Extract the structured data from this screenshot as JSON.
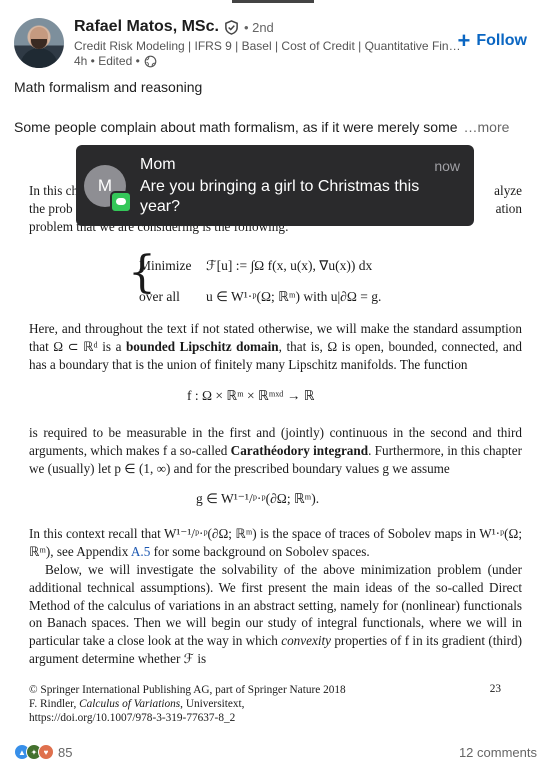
{
  "author": {
    "name": "Rafael Matos, MSc.",
    "degree": "• 2nd",
    "headline": "Credit Risk Modeling | IFRS 9 | Basel | Cost of Credit | Quantitative Finan…",
    "meta": "4h • Edited •"
  },
  "follow_label": "Follow",
  "post": {
    "title": "Math formalism and reasoning",
    "body": "Some people complain about math formalism, as if it were merely some",
    "more": "…more"
  },
  "notification": {
    "initial": "M",
    "sender": "Mom",
    "time": "now",
    "message": "Are you bringing a girl to Christmas this year?"
  },
  "page": {
    "line1a": "In this ch",
    "line1b": "alyze",
    "line2a": "the prob",
    "line2b": "ation",
    "line3": "problem that we are considering is the following:",
    "eq_min_label": "Minimize",
    "eq_min": "ℱ[u] := ∫Ω f(x, u(x), ∇u(x)) dx",
    "eq_over_label": "over all",
    "eq_over": "u ∈ W¹·ᵖ(Ω; ℝᵐ) with u|∂Ω = g.",
    "para1_pre": "Here, and throughout the text if not stated otherwise, we will make the standard assumption that Ω ⊂ ℝᵈ is a ",
    "para1_bold": "bounded Lipschitz domain",
    "para1_post": ", that is, Ω is open, bounded, connected, and has a boundary that is the union of finitely many Lipschitz manifolds. The function",
    "eq_f": "f : Ω × ℝᵐ × ℝᵐˣᵈ → ℝ",
    "para2_pre": "is required to be measurable in the first and (jointly) continuous in the second and third arguments, which makes f a so-called ",
    "para2_bold": "Carathéodory integrand",
    "para2_post": ". Furthermore, in this chapter we (usually) let p ∈ (1, ∞) and for the prescribed boundary values g we assume",
    "eq_g": "g ∈ W¹⁻¹/ᵖ·ᵖ(∂Ω; ℝᵐ).",
    "para3_pre": "In this context recall that W¹⁻¹/ᵖ·ᵖ(∂Ω; ℝᵐ) is the space of traces of Sobolev maps in W¹·ᵖ(Ω; ℝᵐ), see Appendix ",
    "para3_link": "A.5",
    "para3_post": " for some background on Sobolev spaces.",
    "para4": "Below, we will investigate the solvability of the above minimization problem (under additional technical assumptions). We first present the main ideas of the so-called Direct Method of the calculus of variations in an abstract setting, namely for (nonlinear) functionals on Banach spaces. Then we will begin our study of integral functionals, where we will in particular take a close look at the way in which",
    "para4_italic": "convexity",
    "para4_end": " properties of f in its gradient (third) argument determine whether ℱ is",
    "footnote1": "© Springer International Publishing AG, part of Springer Nature 2018",
    "footnote2a": "F. Rindler, ",
    "footnote2_italic": "Calculus of Variations",
    "footnote2b": ", Universitext,",
    "footnote3": "https://doi.org/10.1007/978-3-319-77637-8_2",
    "page_number": "23"
  },
  "footer": {
    "reaction_count": "85",
    "comments": "12 comments"
  },
  "colors": {
    "accent": "#0a66c2",
    "notification_bg": "#2a2a2c",
    "messages_green": "#34c759"
  }
}
